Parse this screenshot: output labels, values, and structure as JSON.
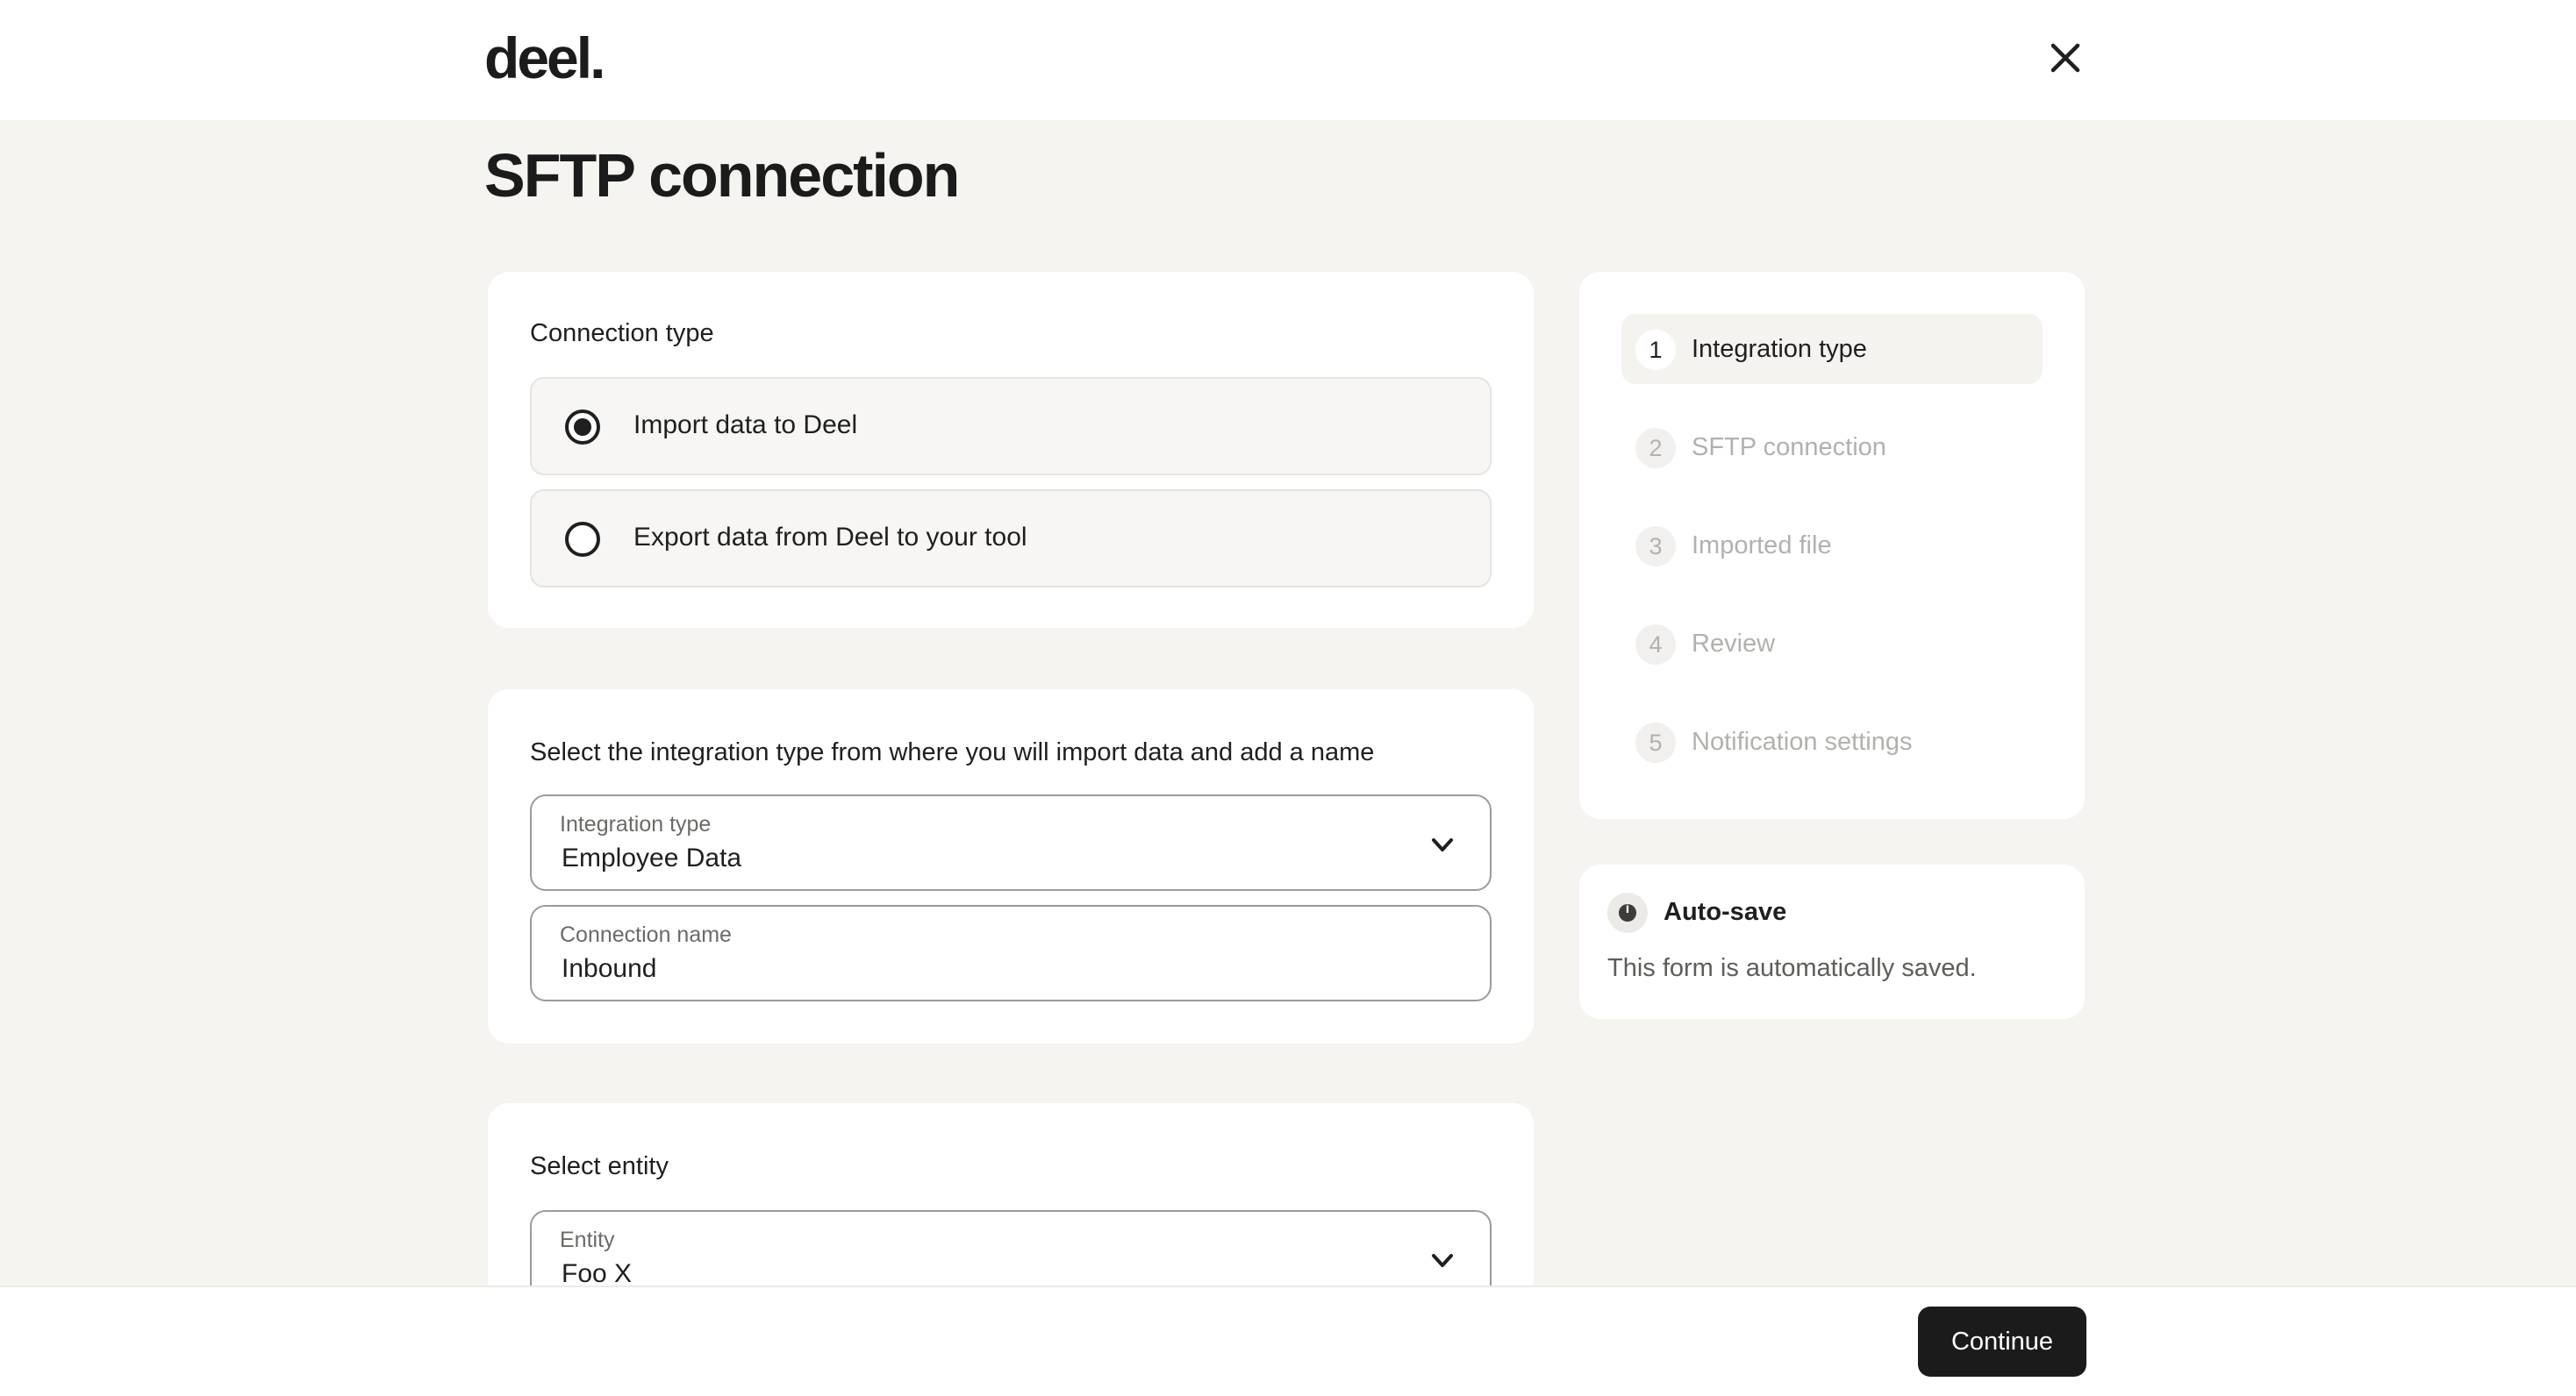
{
  "header": {
    "logo_text": "deel.",
    "close_icon": "close-icon"
  },
  "page": {
    "title": "SFTP connection"
  },
  "connection_type": {
    "title": "Connection type",
    "options": [
      {
        "label": "Import data to Deel",
        "selected": true
      },
      {
        "label": "Export data from Deel to your tool",
        "selected": false
      }
    ]
  },
  "integration": {
    "title": "Select the integration type from where you will import data and add a name",
    "integration_type": {
      "label": "Integration type",
      "value": "Employee Data"
    },
    "connection_name": {
      "label": "Connection name",
      "value": "Inbound"
    }
  },
  "entity": {
    "title": "Select entity",
    "field": {
      "label": "Entity",
      "value": "Foo X"
    }
  },
  "steps": [
    {
      "number": "1",
      "label": "Integration type",
      "active": true
    },
    {
      "number": "2",
      "label": "SFTP connection",
      "active": false
    },
    {
      "number": "3",
      "label": "Imported file",
      "active": false
    },
    {
      "number": "4",
      "label": "Review",
      "active": false
    },
    {
      "number": "5",
      "label": "Notification settings",
      "active": false
    }
  ],
  "autosave": {
    "icon": "info-icon",
    "title": "Auto-save",
    "text": "This form is automatically saved."
  },
  "footer": {
    "continue_label": "Continue"
  },
  "colors": {
    "background": "#f5f4f1",
    "card": "#ffffff",
    "primary_button": "#1b1b1b",
    "muted_text": "#b3b1ad"
  }
}
